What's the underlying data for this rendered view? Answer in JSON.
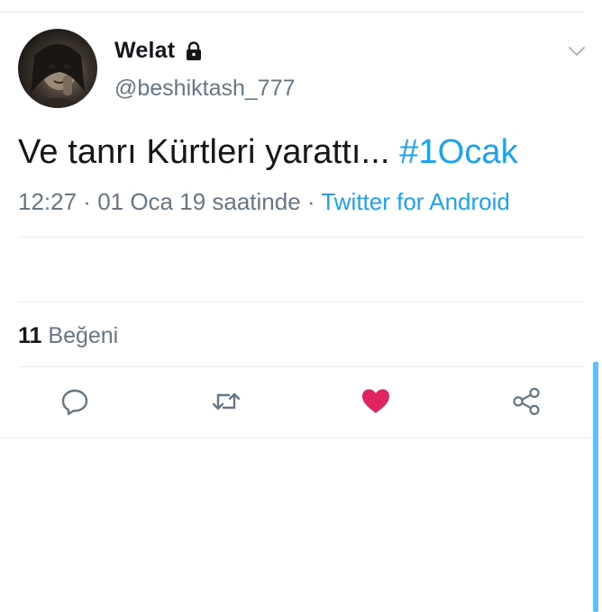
{
  "tweet": {
    "user": {
      "display_name": "Welat",
      "handle": "@beshiktash_777",
      "protected_icon": "lock-icon"
    },
    "text": "Ve tanrı Kürtleri yarattı...",
    "hashtag": "#1Ocak",
    "meta": {
      "time": "12:27",
      "separator1": " · ",
      "date": "01 Oca 19 saatinde",
      "separator2": " · ",
      "source": "Twitter for Android"
    },
    "stats": {
      "likes_count": "11",
      "likes_label": "Beğeni"
    },
    "actions": [
      {
        "name": "reply",
        "icon": "reply-icon"
      },
      {
        "name": "retweet",
        "icon": "retweet-icon"
      },
      {
        "name": "like",
        "icon": "heart-icon",
        "active": true
      },
      {
        "name": "share",
        "icon": "share-icon"
      }
    ]
  },
  "colors": {
    "link": "#1da1f2",
    "secondary_text": "#657786",
    "like_active": "#e0245e",
    "divider": "#e6ecf0"
  }
}
